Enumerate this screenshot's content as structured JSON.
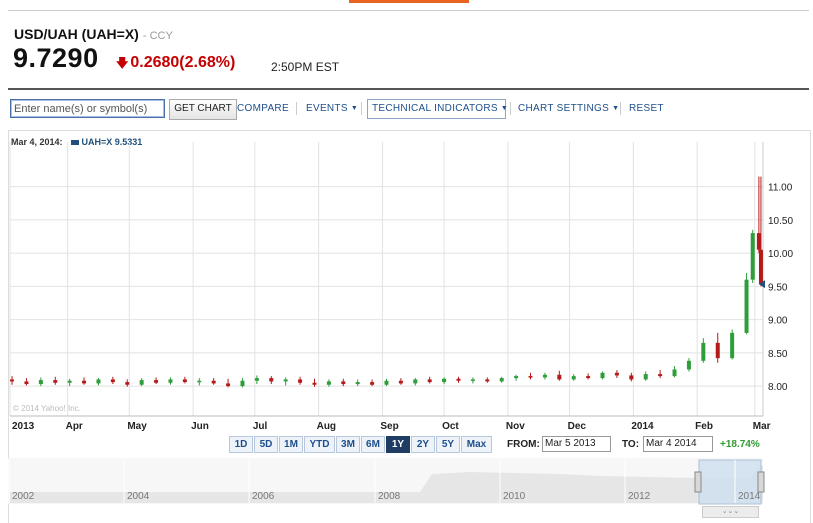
{
  "quote": {
    "symbol_title": "USD/UAH (UAH=X)",
    "exchange": "CCY",
    "price": "9.7290",
    "change": "0.2680(2.68%)",
    "time": "2:50PM EST"
  },
  "toolbar": {
    "symbol_placeholder": "Enter name(s) or symbol(s)",
    "get_chart": "GET CHART",
    "compare": "COMPARE",
    "events": "EVENTS",
    "technical_indicators": "TECHNICAL INDICATORS",
    "chart_settings": "CHART SETTINGS",
    "reset": "RESET"
  },
  "legend": {
    "date": "Mar 4, 2014:",
    "series_label": "UAH=X 9.5331"
  },
  "watermark": "© 2014 Yahoo! Inc.",
  "ranges": [
    "1D",
    "5D",
    "1M",
    "YTD",
    "3M",
    "6M",
    "1Y",
    "2Y",
    "5Y",
    "Max"
  ],
  "active_range": "1Y",
  "period": {
    "from_label": "FROM:",
    "from_value": "Mar 5 2013",
    "to_label": "TO:",
    "to_value": "Mar 4 2014",
    "change_pct": "+18.74%"
  },
  "navigator_years": [
    "2002",
    "2004",
    "2006",
    "2008",
    "2010",
    "2012",
    "2014"
  ],
  "navigator_handle": "⌄⌄⌄",
  "colors": {
    "up": "#2e9e3a",
    "down": "#b51a1a",
    "series": "#1f4f7a",
    "accent": "#e8631f"
  },
  "chart_data": {
    "type": "candlestick",
    "title": "",
    "x_labels": [
      "2013",
      "Apr",
      "May",
      "Jun",
      "Jul",
      "Aug",
      "Sep",
      "Oct",
      "Nov",
      "Dec",
      "2014",
      "Feb",
      "Mar"
    ],
    "y_ticks": [
      8.0,
      8.5,
      9.0,
      9.5,
      10.0,
      10.5,
      11.0
    ],
    "ylim": [
      7.55,
      11.55
    ],
    "grid": true,
    "last_value": 9.5331,
    "weekly": [
      {
        "d": "2013-03-05",
        "o": 8.1,
        "h": 8.15,
        "l": 8.02,
        "c": 8.07
      },
      {
        "d": "2013-03-12",
        "o": 8.07,
        "h": 8.12,
        "l": 8.01,
        "c": 8.03
      },
      {
        "d": "2013-03-19",
        "o": 8.03,
        "h": 8.13,
        "l": 8.0,
        "c": 8.09
      },
      {
        "d": "2013-03-26",
        "o": 8.09,
        "h": 8.14,
        "l": 8.02,
        "c": 8.05
      },
      {
        "d": "2013-04-02",
        "o": 8.05,
        "h": 8.11,
        "l": 8.0,
        "c": 8.08
      },
      {
        "d": "2013-04-09",
        "o": 8.08,
        "h": 8.13,
        "l": 8.02,
        "c": 8.04
      },
      {
        "d": "2013-04-16",
        "o": 8.04,
        "h": 8.12,
        "l": 8.01,
        "c": 8.1
      },
      {
        "d": "2013-04-23",
        "o": 8.1,
        "h": 8.14,
        "l": 8.03,
        "c": 8.06
      },
      {
        "d": "2013-04-30",
        "o": 8.06,
        "h": 8.1,
        "l": 7.99,
        "c": 8.02
      },
      {
        "d": "2013-05-07",
        "o": 8.02,
        "h": 8.12,
        "l": 8.0,
        "c": 8.09
      },
      {
        "d": "2013-05-14",
        "o": 8.09,
        "h": 8.13,
        "l": 8.03,
        "c": 8.05
      },
      {
        "d": "2013-05-21",
        "o": 8.05,
        "h": 8.13,
        "l": 8.02,
        "c": 8.1
      },
      {
        "d": "2013-05-28",
        "o": 8.1,
        "h": 8.14,
        "l": 8.04,
        "c": 8.06
      },
      {
        "d": "2013-06-04",
        "o": 8.06,
        "h": 8.12,
        "l": 8.01,
        "c": 8.08
      },
      {
        "d": "2013-06-11",
        "o": 8.08,
        "h": 8.12,
        "l": 8.02,
        "c": 8.04
      },
      {
        "d": "2013-06-18",
        "o": 8.04,
        "h": 8.11,
        "l": 7.98,
        "c": 8.0
      },
      {
        "d": "2013-06-25",
        "o": 8.0,
        "h": 8.12,
        "l": 7.98,
        "c": 8.08
      },
      {
        "d": "2013-07-02",
        "o": 8.08,
        "h": 8.16,
        "l": 8.03,
        "c": 8.12
      },
      {
        "d": "2013-07-09",
        "o": 8.12,
        "h": 8.15,
        "l": 8.03,
        "c": 8.07
      },
      {
        "d": "2013-07-16",
        "o": 8.07,
        "h": 8.13,
        "l": 8.01,
        "c": 8.1
      },
      {
        "d": "2013-07-23",
        "o": 8.1,
        "h": 8.14,
        "l": 8.02,
        "c": 8.05
      },
      {
        "d": "2013-07-30",
        "o": 8.05,
        "h": 8.11,
        "l": 7.99,
        "c": 8.02
      },
      {
        "d": "2013-08-06",
        "o": 8.02,
        "h": 8.1,
        "l": 7.99,
        "c": 8.07
      },
      {
        "d": "2013-08-13",
        "o": 8.07,
        "h": 8.11,
        "l": 8.0,
        "c": 8.03
      },
      {
        "d": "2013-08-20",
        "o": 8.03,
        "h": 8.1,
        "l": 8.0,
        "c": 8.06
      },
      {
        "d": "2013-08-27",
        "o": 8.06,
        "h": 8.1,
        "l": 8.0,
        "c": 8.02
      },
      {
        "d": "2013-09-03",
        "o": 8.02,
        "h": 8.11,
        "l": 8.0,
        "c": 8.08
      },
      {
        "d": "2013-09-10",
        "o": 8.08,
        "h": 8.12,
        "l": 8.02,
        "c": 8.04
      },
      {
        "d": "2013-09-17",
        "o": 8.04,
        "h": 8.12,
        "l": 8.01,
        "c": 8.1
      },
      {
        "d": "2013-09-24",
        "o": 8.1,
        "h": 8.14,
        "l": 8.04,
        "c": 8.06
      },
      {
        "d": "2013-10-01",
        "o": 8.06,
        "h": 8.13,
        "l": 8.03,
        "c": 8.11
      },
      {
        "d": "2013-10-08",
        "o": 8.11,
        "h": 8.14,
        "l": 8.05,
        "c": 8.08
      },
      {
        "d": "2013-10-15",
        "o": 8.08,
        "h": 8.13,
        "l": 8.04,
        "c": 8.1
      },
      {
        "d": "2013-10-22",
        "o": 8.1,
        "h": 8.13,
        "l": 8.05,
        "c": 8.07
      },
      {
        "d": "2013-10-29",
        "o": 8.07,
        "h": 8.14,
        "l": 8.05,
        "c": 8.12
      },
      {
        "d": "2013-11-05",
        "o": 8.12,
        "h": 8.17,
        "l": 8.08,
        "c": 8.15
      },
      {
        "d": "2013-11-12",
        "o": 8.15,
        "h": 8.2,
        "l": 8.1,
        "c": 8.13
      },
      {
        "d": "2013-11-19",
        "o": 8.13,
        "h": 8.2,
        "l": 8.1,
        "c": 8.17
      },
      {
        "d": "2013-11-26",
        "o": 8.17,
        "h": 8.23,
        "l": 8.08,
        "c": 8.1
      },
      {
        "d": "2013-12-03",
        "o": 8.1,
        "h": 8.18,
        "l": 8.08,
        "c": 8.15
      },
      {
        "d": "2013-12-10",
        "o": 8.15,
        "h": 8.19,
        "l": 8.1,
        "c": 8.12
      },
      {
        "d": "2013-12-17",
        "o": 8.12,
        "h": 8.22,
        "l": 8.1,
        "c": 8.2
      },
      {
        "d": "2013-12-24",
        "o": 8.2,
        "h": 8.24,
        "l": 8.12,
        "c": 8.16
      },
      {
        "d": "2013-12-31",
        "o": 8.16,
        "h": 8.2,
        "l": 8.07,
        "c": 8.1
      },
      {
        "d": "2014-01-07",
        "o": 8.1,
        "h": 8.22,
        "l": 8.08,
        "c": 8.18
      },
      {
        "d": "2014-01-14",
        "o": 8.18,
        "h": 8.24,
        "l": 8.12,
        "c": 8.15
      },
      {
        "d": "2014-01-21",
        "o": 8.15,
        "h": 8.3,
        "l": 8.13,
        "c": 8.25
      },
      {
        "d": "2014-01-28",
        "o": 8.25,
        "h": 8.42,
        "l": 8.22,
        "c": 8.38
      },
      {
        "d": "2014-02-04",
        "o": 8.38,
        "h": 8.72,
        "l": 8.35,
        "c": 8.65
      },
      {
        "d": "2014-02-11",
        "o": 8.65,
        "h": 8.8,
        "l": 8.35,
        "c": 8.42
      },
      {
        "d": "2014-02-18",
        "o": 8.42,
        "h": 8.85,
        "l": 8.4,
        "c": 8.8
      },
      {
        "d": "2014-02-25",
        "o": 8.8,
        "h": 9.7,
        "l": 8.78,
        "c": 9.6
      },
      {
        "d": "2014-02-28",
        "o": 9.6,
        "h": 10.35,
        "l": 9.55,
        "c": 10.3
      },
      {
        "d": "2014-03-03",
        "o": 10.3,
        "h": 11.15,
        "l": 10.0,
        "c": 10.05
      },
      {
        "d": "2014-03-04",
        "o": 10.05,
        "h": 11.15,
        "l": 9.5,
        "c": 9.53
      }
    ]
  }
}
